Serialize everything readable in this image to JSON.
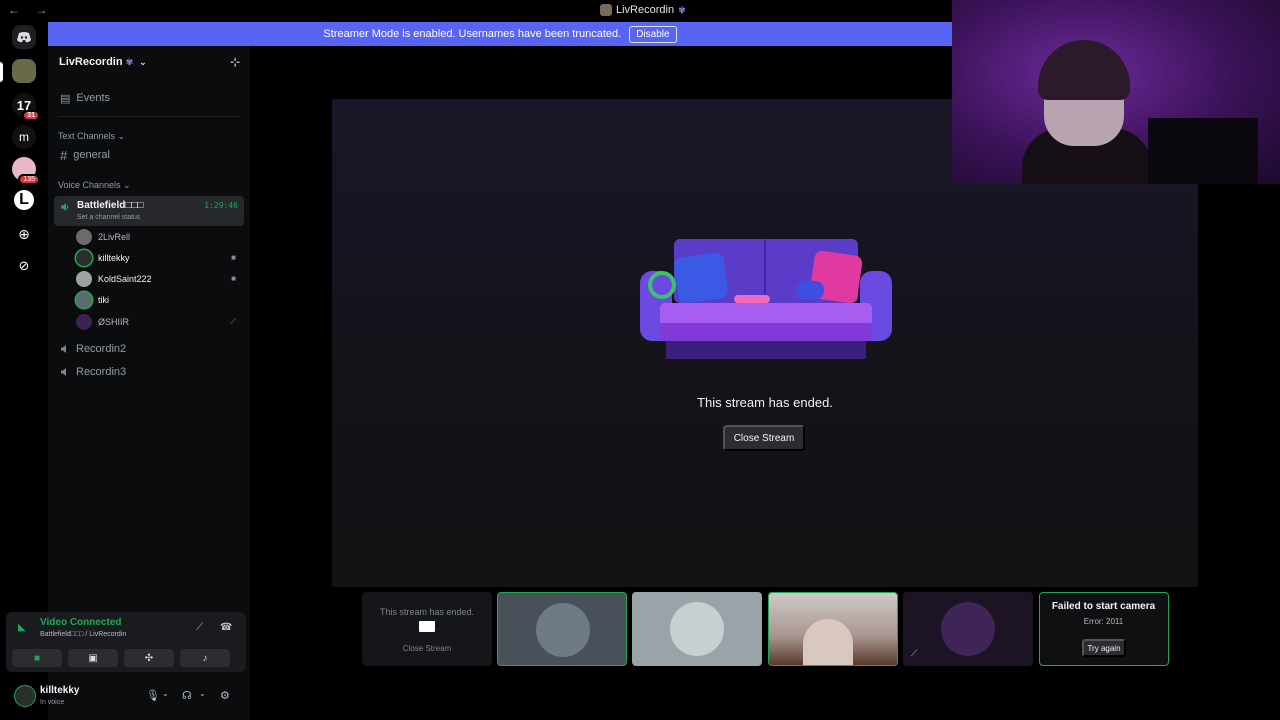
{
  "window": {
    "title": "LivRecordin",
    "nav_arrows": "← →"
  },
  "banner": {
    "text": "Streamer Mode is enabled. Usernames have been truncated.",
    "button": "Disable"
  },
  "guilds": [
    {
      "name": "home",
      "icon": "discord-icon"
    },
    {
      "name": "server-avatar-1",
      "badge": ""
    },
    {
      "name": "server-17",
      "label": "17",
      "badge": "31"
    },
    {
      "name": "server-m",
      "label": "m",
      "badge": ""
    },
    {
      "name": "server-pink",
      "badge": "135"
    },
    {
      "name": "server-L",
      "label": "L",
      "badge": ""
    },
    {
      "name": "add-server",
      "icon": "plus-icon"
    },
    {
      "name": "discover",
      "icon": "compass-icon"
    }
  ],
  "sidebar": {
    "server_name": "LivRecordin",
    "events_label": "Events",
    "text_category": "Text Channels",
    "text_channels": [
      "general"
    ],
    "voice_category": "Voice Channels",
    "active_voice": {
      "name": "Battlefield□□□",
      "status": "Set a channel status",
      "timer": "1:29:46"
    },
    "members": [
      {
        "name": "2LivRell",
        "icon": ""
      },
      {
        "name": "killtekky",
        "icon": "camera-icon"
      },
      {
        "name": "KoldSaint222",
        "icon": "camera-icon"
      },
      {
        "name": "tiki",
        "icon": ""
      },
      {
        "name": "ØSHIIR",
        "icon": "mic-muted-icon"
      }
    ],
    "other_voice": [
      "Recordin2",
      "Recordin3"
    ]
  },
  "voice_panel": {
    "title": "Video Connected",
    "subtitle": "Battlefield□□□ / LivRecordin",
    "buttons": [
      "camera",
      "screen-share",
      "activities",
      "soundboard"
    ]
  },
  "user": {
    "name": "killtekky",
    "status": "In voice"
  },
  "stage": {
    "message": "This stream has ended.",
    "close_label": "Close Stream"
  },
  "tiles": {
    "ended_message": "This stream has ended.",
    "ended_close": "Close Stream",
    "fail_title": "Failed to start camera",
    "fail_error": "Error: 2011",
    "fail_button": "Try again"
  },
  "colors": {
    "accent": "#5865f2",
    "green": "#23a55a",
    "sidebar": "#0b0c0e"
  }
}
